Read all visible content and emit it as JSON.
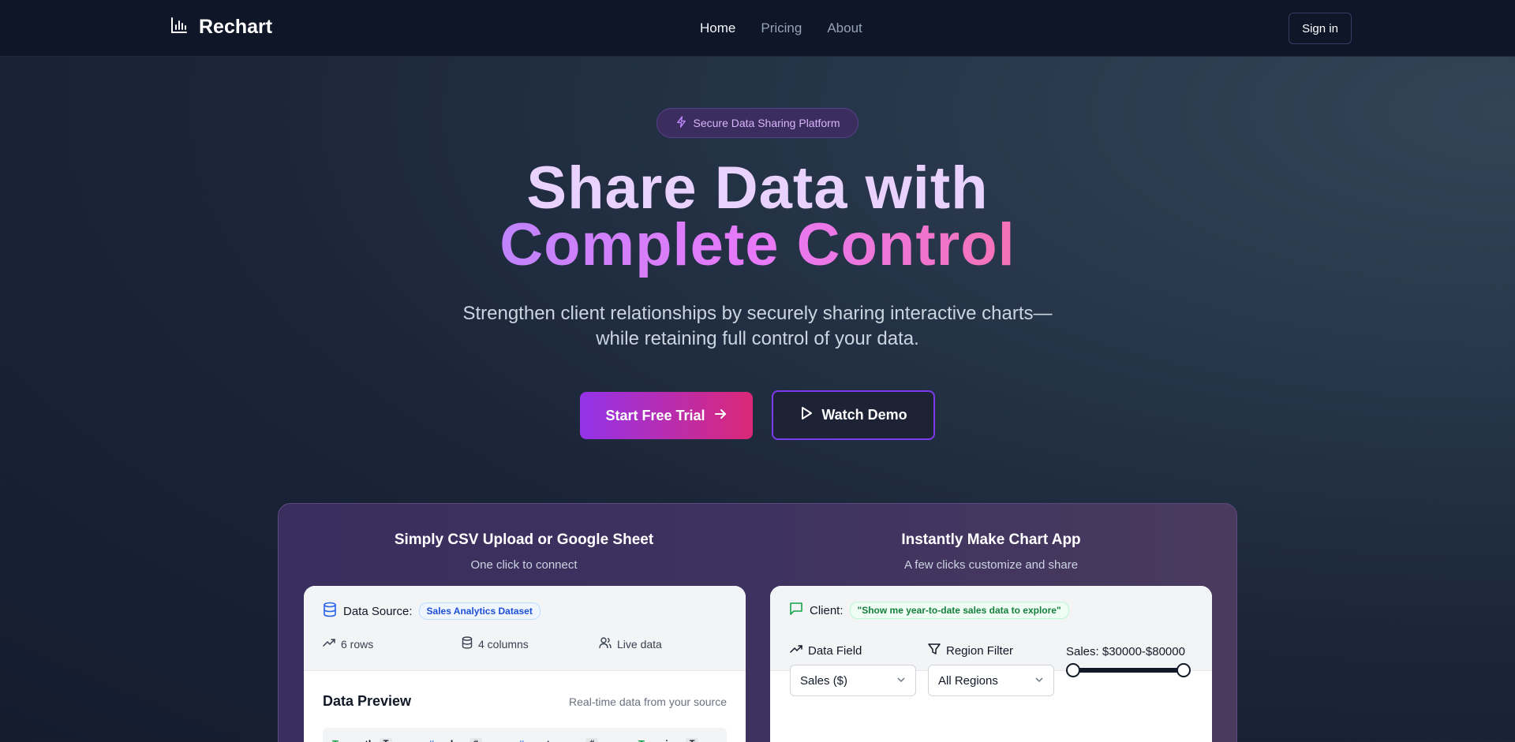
{
  "nav": {
    "brand": "Rechart",
    "links": [
      "Home",
      "Pricing",
      "About"
    ],
    "signin": "Sign in"
  },
  "hero": {
    "badge": "Secure Data Sharing Platform",
    "title_line1": "Share Data with",
    "title_line2": "Complete Control",
    "subtitle": "Strengthen client relationships by securely sharing interactive charts—while retaining full control of your data.",
    "primary_cta": "Start Free Trial",
    "secondary_cta": "Watch Demo"
  },
  "showcase": {
    "left": {
      "title": "Simply CSV Upload or Google Sheet",
      "subtitle": "One click to connect",
      "source_label": "Data Source:",
      "source_name": "Sales Analytics Dataset",
      "rows": "6 rows",
      "columns": "4 columns",
      "live": "Live data",
      "preview_title": "Data Preview",
      "preview_sub": "Real-time data from your source",
      "columns_list": [
        {
          "name": "month",
          "type": "T"
        },
        {
          "name": "sales",
          "type": "#"
        },
        {
          "name": "customers",
          "type": "#"
        },
        {
          "name": "region",
          "type": "T"
        }
      ]
    },
    "right": {
      "title": "Instantly Make Chart App",
      "subtitle": "A few clicks customize and share",
      "client_label": "Client:",
      "client_quote": "\"Show me year-to-date sales data to explore\"",
      "field_label": "Data Field",
      "field_value": "Sales ($)",
      "region_label": "Region Filter",
      "region_value": "All Regions",
      "range_label": "Sales: $30000-$80000"
    }
  },
  "colors": {
    "accent_purple": "#9333ea",
    "accent_pink": "#db2777",
    "nav_bg": "#0e1628"
  }
}
